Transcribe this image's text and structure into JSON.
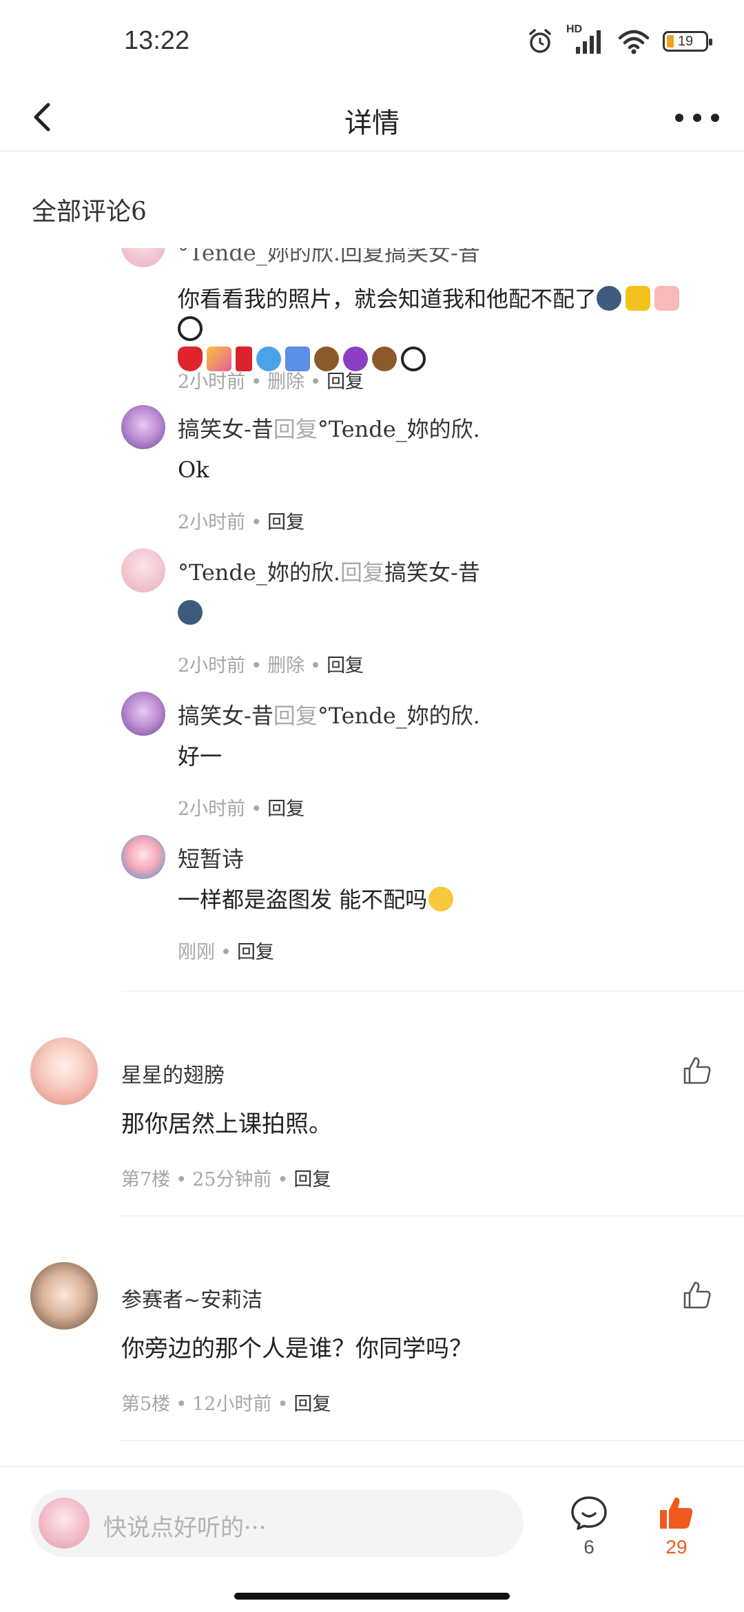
{
  "status_bar": {
    "time": "13:22",
    "battery": "19",
    "network_label": "HD"
  },
  "header": {
    "title": "详情"
  },
  "comments_section": {
    "title": "全部评论6"
  },
  "replies": [
    {
      "head_partial": "°Tende_妳的欣.回复搞笑女-昔",
      "text": "你看看我的照片，就会知道我和他配不配了",
      "time": "2小时前",
      "delete": "删除",
      "reply": "回复"
    },
    {
      "author": "搞笑女-昔",
      "reply_word": "回复",
      "target": "°Tende_妳的欣.",
      "text": "Ok",
      "time": "2小时前",
      "reply": "回复"
    },
    {
      "author": "°Tende_妳的欣.",
      "reply_word": "回复",
      "target": "搞笑女-昔",
      "text": "",
      "time": "2小时前",
      "delete": "删除",
      "reply": "回复"
    },
    {
      "author": "搞笑女-昔",
      "reply_word": "回复",
      "target": "°Tende_妳的欣.",
      "text": "好一",
      "time": "2小时前",
      "reply": "回复"
    },
    {
      "author": "短暂诗",
      "text": "一样都是盗图发 能不配吗",
      "time": "刚刚",
      "reply": "回复"
    }
  ],
  "comments": [
    {
      "author": "星星的翅膀",
      "text": "那你居然上课拍照。",
      "floor": "第7楼",
      "time": "25分钟前",
      "reply": "回复"
    },
    {
      "author": "参赛者~安莉洁",
      "text": "你旁边的那个人是谁？你同学吗？",
      "floor": "第5楼",
      "time": "12小时前",
      "reply": "回复"
    }
  ],
  "bottom_bar": {
    "placeholder": "快说点好听的···",
    "comment_count": "6",
    "like_count": "29"
  },
  "colors": {
    "accent": "#f05a1e",
    "muted": "#a6a6a6",
    "reply_word": "#a9a9a9"
  },
  "icons": [
    "back-icon",
    "more-icon",
    "thumb-up-icon",
    "comment-bubble-icon",
    "alarm-icon",
    "signal-icon",
    "wifi-icon",
    "battery-icon"
  ]
}
